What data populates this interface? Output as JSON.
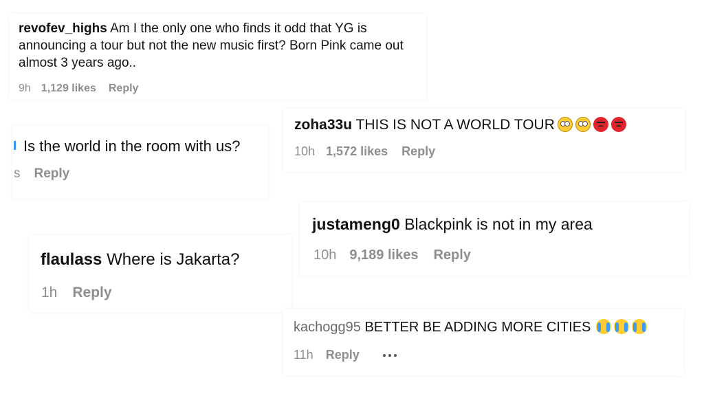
{
  "comments": {
    "c1": {
      "username": "revofev_highs",
      "text": "Am I the only one who finds it odd that YG is announcing a tour but not the new music first? Born Pink came out almost 3 years ago..",
      "time": "9h",
      "likes": "1,129 likes",
      "reply": "Reply"
    },
    "c2": {
      "username": "zoha33u",
      "text": "THIS IS NOT A WORLD TOUR",
      "time": "10h",
      "likes": "1,572 likes",
      "reply": "Reply",
      "emojis": [
        "face-with-rolling-eyes",
        "face-with-rolling-eyes",
        "angry-face",
        "angry-face"
      ]
    },
    "c3": {
      "text": "Is the world in the room with us?",
      "time_fragment": "s",
      "reply": "Reply"
    },
    "c4": {
      "username": "justameng0",
      "text": "Blackpink is not in my area",
      "time": "10h",
      "likes": "9,189 likes",
      "reply": "Reply"
    },
    "c5": {
      "username": "flaulass",
      "text": "Where is Jakarta?",
      "time": "1h",
      "reply": "Reply"
    },
    "c6": {
      "username": "kachogg95",
      "text": "BETTER BE ADDING MORE CITIES",
      "time": "11h",
      "reply": "Reply",
      "emojis": [
        "loudly-crying-face",
        "loudly-crying-face",
        "loudly-crying-face"
      ]
    }
  },
  "colors": {
    "text": "#111111",
    "meta": "#8e8e8e",
    "accent_fragment": "#3797f0"
  }
}
